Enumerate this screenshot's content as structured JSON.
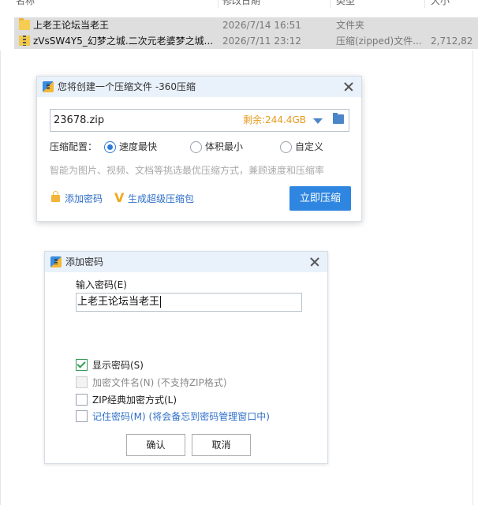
{
  "explorer": {
    "columns": {
      "name": "名称",
      "date": "修改日期",
      "type": "类型",
      "size": "大小"
    },
    "files": [
      {
        "icon": "folder-icon",
        "name": "上老王论坛当老王",
        "date": "2026/7/14 16:51",
        "type": "文件夹",
        "size": ""
      },
      {
        "icon": "zip-file-icon",
        "name": "zVsSW4Y5_幻梦之城.二次元老婆梦之城...",
        "date": "2026/7/11 23:12",
        "type": "压缩(zipped)文件...",
        "size": "2,712,82"
      }
    ]
  },
  "compress_dialog": {
    "title": "您将创建一个压缩文件 -360压缩",
    "filename": "23678.zip",
    "remaining_space": "剩余:244.4GB",
    "config_label": "压缩配置：",
    "options": [
      {
        "label": "速度最快",
        "selected": true
      },
      {
        "label": "体积最小",
        "selected": false
      },
      {
        "label": "自定义",
        "selected": false
      }
    ],
    "hint": "智能为图片、视频、文档等挑选最优压缩方式，兼顾速度和压缩率",
    "add_password_link": "添加密码",
    "super_compress_link": "生成超级压缩包",
    "compress_button": "立即压缩"
  },
  "password_dialog": {
    "title": "添加密码",
    "input_label": "输入密码(E)",
    "password_value": "上老王论坛当老王",
    "checkboxes": [
      {
        "label": "显示密码(S)",
        "checked": true,
        "disabled": false,
        "color": "#222222"
      },
      {
        "label": "加密文件名(N) (不支持ZIP格式)",
        "checked": false,
        "disabled": true,
        "color": "#8a8a8a"
      },
      {
        "label": "ZIP经典加密方式(L)",
        "checked": false,
        "disabled": false,
        "color": "#222222"
      },
      {
        "label": "记住密码(M) (将会备忘到密码管理窗口中)",
        "checked": false,
        "disabled": false,
        "color": "#2f6fc9"
      }
    ],
    "ok_button": "确认",
    "cancel_button": "取消"
  },
  "colors": {
    "accent": "#2f86e0",
    "remaining_space": "#e69a1c",
    "link": "#2f6fc9",
    "row_selected": "#dedede"
  }
}
